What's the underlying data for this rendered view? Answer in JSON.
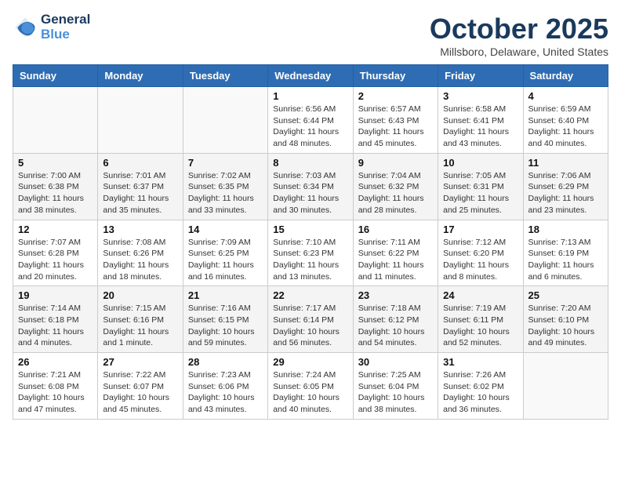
{
  "header": {
    "logo_line1": "General",
    "logo_line2": "Blue",
    "month_title": "October 2025",
    "location": "Millsboro, Delaware, United States"
  },
  "days_of_week": [
    "Sunday",
    "Monday",
    "Tuesday",
    "Wednesday",
    "Thursday",
    "Friday",
    "Saturday"
  ],
  "weeks": [
    [
      {
        "day": "",
        "info": ""
      },
      {
        "day": "",
        "info": ""
      },
      {
        "day": "",
        "info": ""
      },
      {
        "day": "1",
        "info": "Sunrise: 6:56 AM\nSunset: 6:44 PM\nDaylight: 11 hours\nand 48 minutes."
      },
      {
        "day": "2",
        "info": "Sunrise: 6:57 AM\nSunset: 6:43 PM\nDaylight: 11 hours\nand 45 minutes."
      },
      {
        "day": "3",
        "info": "Sunrise: 6:58 AM\nSunset: 6:41 PM\nDaylight: 11 hours\nand 43 minutes."
      },
      {
        "day": "4",
        "info": "Sunrise: 6:59 AM\nSunset: 6:40 PM\nDaylight: 11 hours\nand 40 minutes."
      }
    ],
    [
      {
        "day": "5",
        "info": "Sunrise: 7:00 AM\nSunset: 6:38 PM\nDaylight: 11 hours\nand 38 minutes."
      },
      {
        "day": "6",
        "info": "Sunrise: 7:01 AM\nSunset: 6:37 PM\nDaylight: 11 hours\nand 35 minutes."
      },
      {
        "day": "7",
        "info": "Sunrise: 7:02 AM\nSunset: 6:35 PM\nDaylight: 11 hours\nand 33 minutes."
      },
      {
        "day": "8",
        "info": "Sunrise: 7:03 AM\nSunset: 6:34 PM\nDaylight: 11 hours\nand 30 minutes."
      },
      {
        "day": "9",
        "info": "Sunrise: 7:04 AM\nSunset: 6:32 PM\nDaylight: 11 hours\nand 28 minutes."
      },
      {
        "day": "10",
        "info": "Sunrise: 7:05 AM\nSunset: 6:31 PM\nDaylight: 11 hours\nand 25 minutes."
      },
      {
        "day": "11",
        "info": "Sunrise: 7:06 AM\nSunset: 6:29 PM\nDaylight: 11 hours\nand 23 minutes."
      }
    ],
    [
      {
        "day": "12",
        "info": "Sunrise: 7:07 AM\nSunset: 6:28 PM\nDaylight: 11 hours\nand 20 minutes."
      },
      {
        "day": "13",
        "info": "Sunrise: 7:08 AM\nSunset: 6:26 PM\nDaylight: 11 hours\nand 18 minutes."
      },
      {
        "day": "14",
        "info": "Sunrise: 7:09 AM\nSunset: 6:25 PM\nDaylight: 11 hours\nand 16 minutes."
      },
      {
        "day": "15",
        "info": "Sunrise: 7:10 AM\nSunset: 6:23 PM\nDaylight: 11 hours\nand 13 minutes."
      },
      {
        "day": "16",
        "info": "Sunrise: 7:11 AM\nSunset: 6:22 PM\nDaylight: 11 hours\nand 11 minutes."
      },
      {
        "day": "17",
        "info": "Sunrise: 7:12 AM\nSunset: 6:20 PM\nDaylight: 11 hours\nand 8 minutes."
      },
      {
        "day": "18",
        "info": "Sunrise: 7:13 AM\nSunset: 6:19 PM\nDaylight: 11 hours\nand 6 minutes."
      }
    ],
    [
      {
        "day": "19",
        "info": "Sunrise: 7:14 AM\nSunset: 6:18 PM\nDaylight: 11 hours\nand 4 minutes."
      },
      {
        "day": "20",
        "info": "Sunrise: 7:15 AM\nSunset: 6:16 PM\nDaylight: 11 hours\nand 1 minute."
      },
      {
        "day": "21",
        "info": "Sunrise: 7:16 AM\nSunset: 6:15 PM\nDaylight: 10 hours\nand 59 minutes."
      },
      {
        "day": "22",
        "info": "Sunrise: 7:17 AM\nSunset: 6:14 PM\nDaylight: 10 hours\nand 56 minutes."
      },
      {
        "day": "23",
        "info": "Sunrise: 7:18 AM\nSunset: 6:12 PM\nDaylight: 10 hours\nand 54 minutes."
      },
      {
        "day": "24",
        "info": "Sunrise: 7:19 AM\nSunset: 6:11 PM\nDaylight: 10 hours\nand 52 minutes."
      },
      {
        "day": "25",
        "info": "Sunrise: 7:20 AM\nSunset: 6:10 PM\nDaylight: 10 hours\nand 49 minutes."
      }
    ],
    [
      {
        "day": "26",
        "info": "Sunrise: 7:21 AM\nSunset: 6:08 PM\nDaylight: 10 hours\nand 47 minutes."
      },
      {
        "day": "27",
        "info": "Sunrise: 7:22 AM\nSunset: 6:07 PM\nDaylight: 10 hours\nand 45 minutes."
      },
      {
        "day": "28",
        "info": "Sunrise: 7:23 AM\nSunset: 6:06 PM\nDaylight: 10 hours\nand 43 minutes."
      },
      {
        "day": "29",
        "info": "Sunrise: 7:24 AM\nSunset: 6:05 PM\nDaylight: 10 hours\nand 40 minutes."
      },
      {
        "day": "30",
        "info": "Sunrise: 7:25 AM\nSunset: 6:04 PM\nDaylight: 10 hours\nand 38 minutes."
      },
      {
        "day": "31",
        "info": "Sunrise: 7:26 AM\nSunset: 6:02 PM\nDaylight: 10 hours\nand 36 minutes."
      },
      {
        "day": "",
        "info": ""
      }
    ]
  ]
}
